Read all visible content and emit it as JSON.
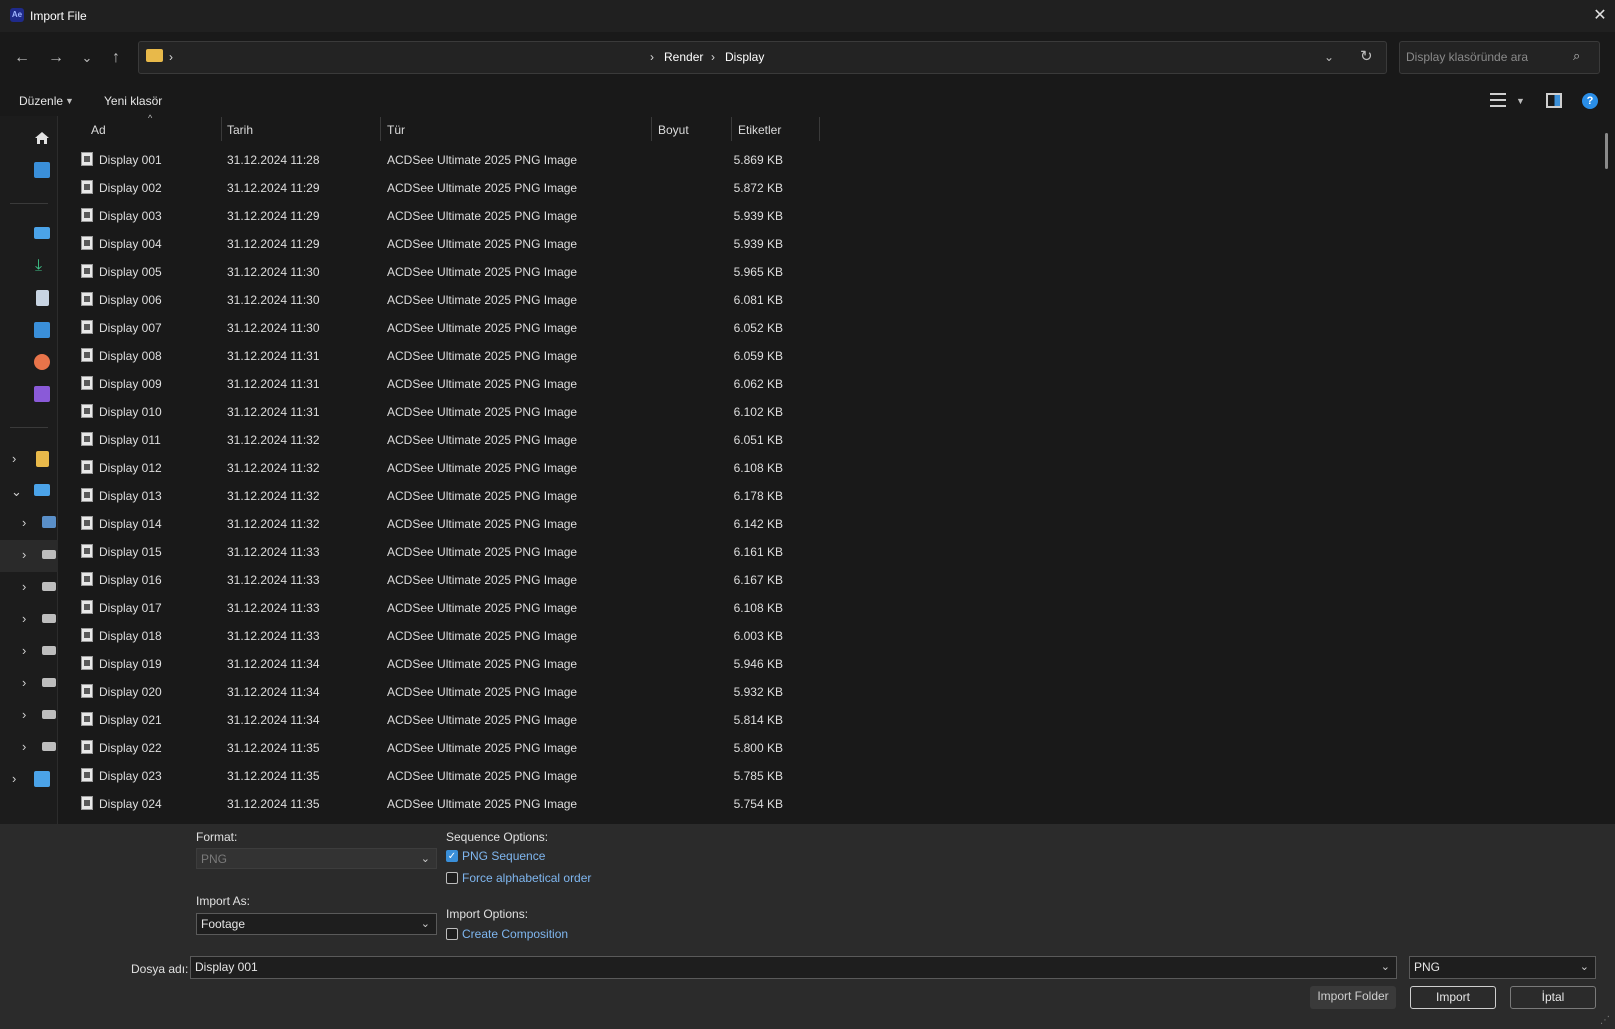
{
  "window": {
    "title": "Import File",
    "app_badge": "Ae",
    "close_glyph": "✕"
  },
  "nav": {
    "back": "←",
    "forward": "→",
    "recent": "⌄",
    "up": "↑"
  },
  "address": {
    "sep": "›",
    "crumbs": [
      "Render",
      "Display"
    ],
    "dropdown": "⌄",
    "refresh": "↻"
  },
  "search": {
    "placeholder": "Display klasöründe ara",
    "icon": "search-icon"
  },
  "commands": {
    "organize": "Düzenle",
    "new_folder": "Yeni klasör",
    "help": "?"
  },
  "columns": {
    "name": "Ad",
    "date": "Tarih",
    "type": "Tür",
    "size": "Boyut",
    "tags": "Etiketler"
  },
  "files": [
    {
      "name": "Display 001",
      "date": "31.12.2024 11:28",
      "type": "ACDSee Ultimate 2025 PNG Image",
      "size": "5.869 KB"
    },
    {
      "name": "Display 002",
      "date": "31.12.2024 11:29",
      "type": "ACDSee Ultimate 2025 PNG Image",
      "size": "5.872 KB"
    },
    {
      "name": "Display 003",
      "date": "31.12.2024 11:29",
      "type": "ACDSee Ultimate 2025 PNG Image",
      "size": "5.939 KB"
    },
    {
      "name": "Display 004",
      "date": "31.12.2024 11:29",
      "type": "ACDSee Ultimate 2025 PNG Image",
      "size": "5.939 KB"
    },
    {
      "name": "Display 005",
      "date": "31.12.2024 11:30",
      "type": "ACDSee Ultimate 2025 PNG Image",
      "size": "5.965 KB"
    },
    {
      "name": "Display 006",
      "date": "31.12.2024 11:30",
      "type": "ACDSee Ultimate 2025 PNG Image",
      "size": "6.081 KB"
    },
    {
      "name": "Display 007",
      "date": "31.12.2024 11:30",
      "type": "ACDSee Ultimate 2025 PNG Image",
      "size": "6.052 KB"
    },
    {
      "name": "Display 008",
      "date": "31.12.2024 11:31",
      "type": "ACDSee Ultimate 2025 PNG Image",
      "size": "6.059 KB"
    },
    {
      "name": "Display 009",
      "date": "31.12.2024 11:31",
      "type": "ACDSee Ultimate 2025 PNG Image",
      "size": "6.062 KB"
    },
    {
      "name": "Display 010",
      "date": "31.12.2024 11:31",
      "type": "ACDSee Ultimate 2025 PNG Image",
      "size": "6.102 KB"
    },
    {
      "name": "Display 011",
      "date": "31.12.2024 11:32",
      "type": "ACDSee Ultimate 2025 PNG Image",
      "size": "6.051 KB"
    },
    {
      "name": "Display 012",
      "date": "31.12.2024 11:32",
      "type": "ACDSee Ultimate 2025 PNG Image",
      "size": "6.108 KB"
    },
    {
      "name": "Display 013",
      "date": "31.12.2024 11:32",
      "type": "ACDSee Ultimate 2025 PNG Image",
      "size": "6.178 KB"
    },
    {
      "name": "Display 014",
      "date": "31.12.2024 11:32",
      "type": "ACDSee Ultimate 2025 PNG Image",
      "size": "6.142 KB"
    },
    {
      "name": "Display 015",
      "date": "31.12.2024 11:33",
      "type": "ACDSee Ultimate 2025 PNG Image",
      "size": "6.161 KB"
    },
    {
      "name": "Display 016",
      "date": "31.12.2024 11:33",
      "type": "ACDSee Ultimate 2025 PNG Image",
      "size": "6.167 KB"
    },
    {
      "name": "Display 017",
      "date": "31.12.2024 11:33",
      "type": "ACDSee Ultimate 2025 PNG Image",
      "size": "6.108 KB"
    },
    {
      "name": "Display 018",
      "date": "31.12.2024 11:33",
      "type": "ACDSee Ultimate 2025 PNG Image",
      "size": "6.003 KB"
    },
    {
      "name": "Display 019",
      "date": "31.12.2024 11:34",
      "type": "ACDSee Ultimate 2025 PNG Image",
      "size": "5.946 KB"
    },
    {
      "name": "Display 020",
      "date": "31.12.2024 11:34",
      "type": "ACDSee Ultimate 2025 PNG Image",
      "size": "5.932 KB"
    },
    {
      "name": "Display 021",
      "date": "31.12.2024 11:34",
      "type": "ACDSee Ultimate 2025 PNG Image",
      "size": "5.814 KB"
    },
    {
      "name": "Display 022",
      "date": "31.12.2024 11:35",
      "type": "ACDSee Ultimate 2025 PNG Image",
      "size": "5.800 KB"
    },
    {
      "name": "Display 023",
      "date": "31.12.2024 11:35",
      "type": "ACDSee Ultimate 2025 PNG Image",
      "size": "5.785 KB"
    },
    {
      "name": "Display 024",
      "date": "31.12.2024 11:35",
      "type": "ACDSee Ultimate 2025 PNG Image",
      "size": "5.754 KB"
    }
  ],
  "options": {
    "format_label": "Format:",
    "format_value": "PNG",
    "import_as_label": "Import As:",
    "import_as_value": "Footage",
    "sequence_label": "Sequence Options:",
    "png_sequence": "PNG Sequence",
    "png_sequence_checked": true,
    "force_alpha": "Force alphabetical order",
    "force_alpha_checked": false,
    "import_options_label": "Import Options:",
    "create_comp": "Create Composition",
    "create_comp_checked": false
  },
  "footer": {
    "filename_label": "Dosya adı:",
    "filename_value": "Display 001",
    "filetype_value": "PNG",
    "import_folder": "Import Folder",
    "import": "Import",
    "cancel": "İptal"
  },
  "colors": {
    "accent": "#3a8fd9",
    "link": "#7fb6ef",
    "folder": "#e8b94a"
  }
}
